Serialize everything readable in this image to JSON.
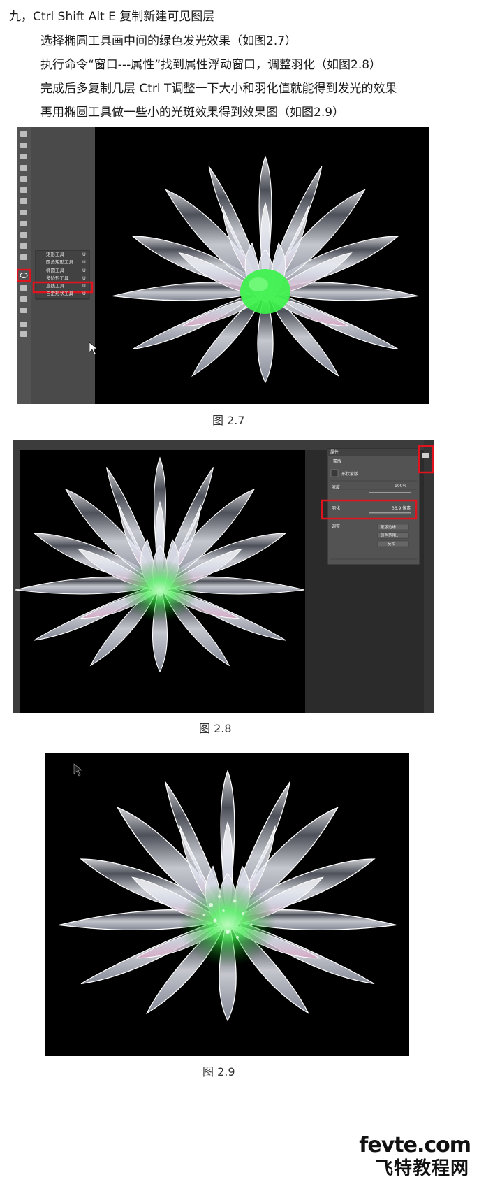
{
  "text": {
    "line1": "九，Ctrl  Shift  Alt  E 复制新建可见图层",
    "line2": "选择椭圆工具画中间的绿色发光效果（如图2.7）",
    "line3": "执行命令“窗口---属性”找到属性浮动窗口，调整羽化（如图2.8）",
    "line4": "完成后多复制几层 Ctrl  T调整一下大小和羽化值就能得到发光的效果",
    "line5": "再用椭圆工具做一些小的光斑效果得到效果图（如图2.9）"
  },
  "figures": {
    "fig27_caption": "图  2.7",
    "fig28_caption": "图  2.8",
    "fig29_caption": "图  2.9"
  },
  "ps_toolbar_flyout": {
    "items": [
      "矩形工具",
      "圆角矩形工具",
      "椭圆工具",
      "多边形工具",
      "直线工具",
      "自定形状工具"
    ],
    "shortcut": "U",
    "selected_index": 2
  },
  "properties_panel": {
    "tab": "属性",
    "sub": "蒙版",
    "item_label": "形状蒙版",
    "density_label": "浓度",
    "density_value": "100%",
    "feather_label": "羽化",
    "feather_value": "36.9 像素",
    "adjust_label": "调整",
    "buttons": [
      "蒙版边缘...",
      "颜色范围...",
      "反相"
    ]
  },
  "watermark": {
    "domain": "fevte.com",
    "name": "飞特教程网"
  },
  "colors": {
    "highlight_red": "#e0141e",
    "glow_green": "#3bf24a",
    "ps_panel": "#535353",
    "ps_dark": "#3c3c3c"
  }
}
